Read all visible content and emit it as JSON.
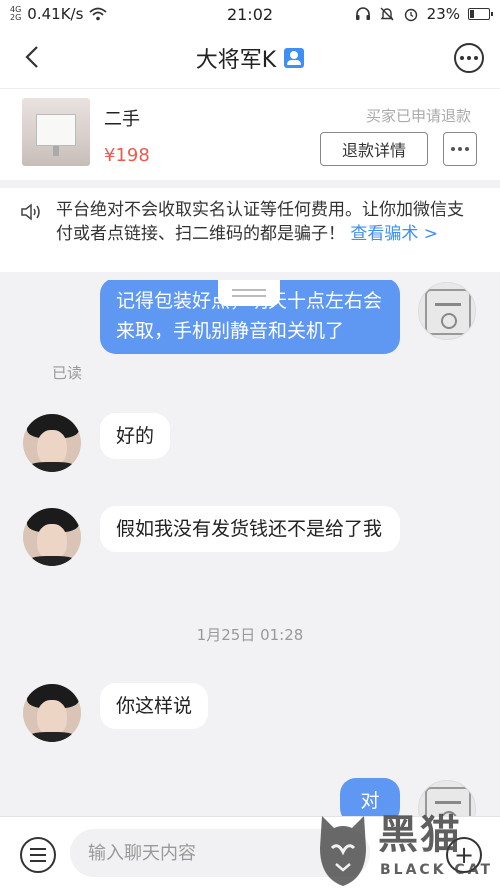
{
  "status_bar": {
    "network_top": "4G",
    "network_bottom": "2G",
    "speed": "0.41K/s",
    "time": "21:02",
    "battery": "23%",
    "battery_level": 0.23
  },
  "header": {
    "title": "大将军K"
  },
  "product": {
    "name": "二手",
    "price": "¥198",
    "status": "买家已申请退款",
    "refund_button": "退款详情"
  },
  "notice": {
    "text": "平台绝对不会收取实名认证等任何费用。让你加微信支付或者点链接、扫二维码的都是骗子！",
    "link": "查看骗术 >"
  },
  "messages": [
    {
      "sender": "me",
      "text": "记得包装好点，明天十点左右会来取，手机别静音和关机了",
      "read_label": "已读"
    },
    {
      "sender": "other",
      "text": "好的"
    },
    {
      "sender": "other",
      "text": "假如我没有发货钱还不是给了我"
    },
    {
      "sender": "other",
      "text": "你这样说"
    },
    {
      "sender": "me",
      "text": "对"
    }
  ],
  "time_separator": "1月25日 01:28",
  "input": {
    "placeholder": "输入聊天内容"
  },
  "watermark": {
    "cn": "黑猫",
    "en": "BLACK CAT"
  }
}
